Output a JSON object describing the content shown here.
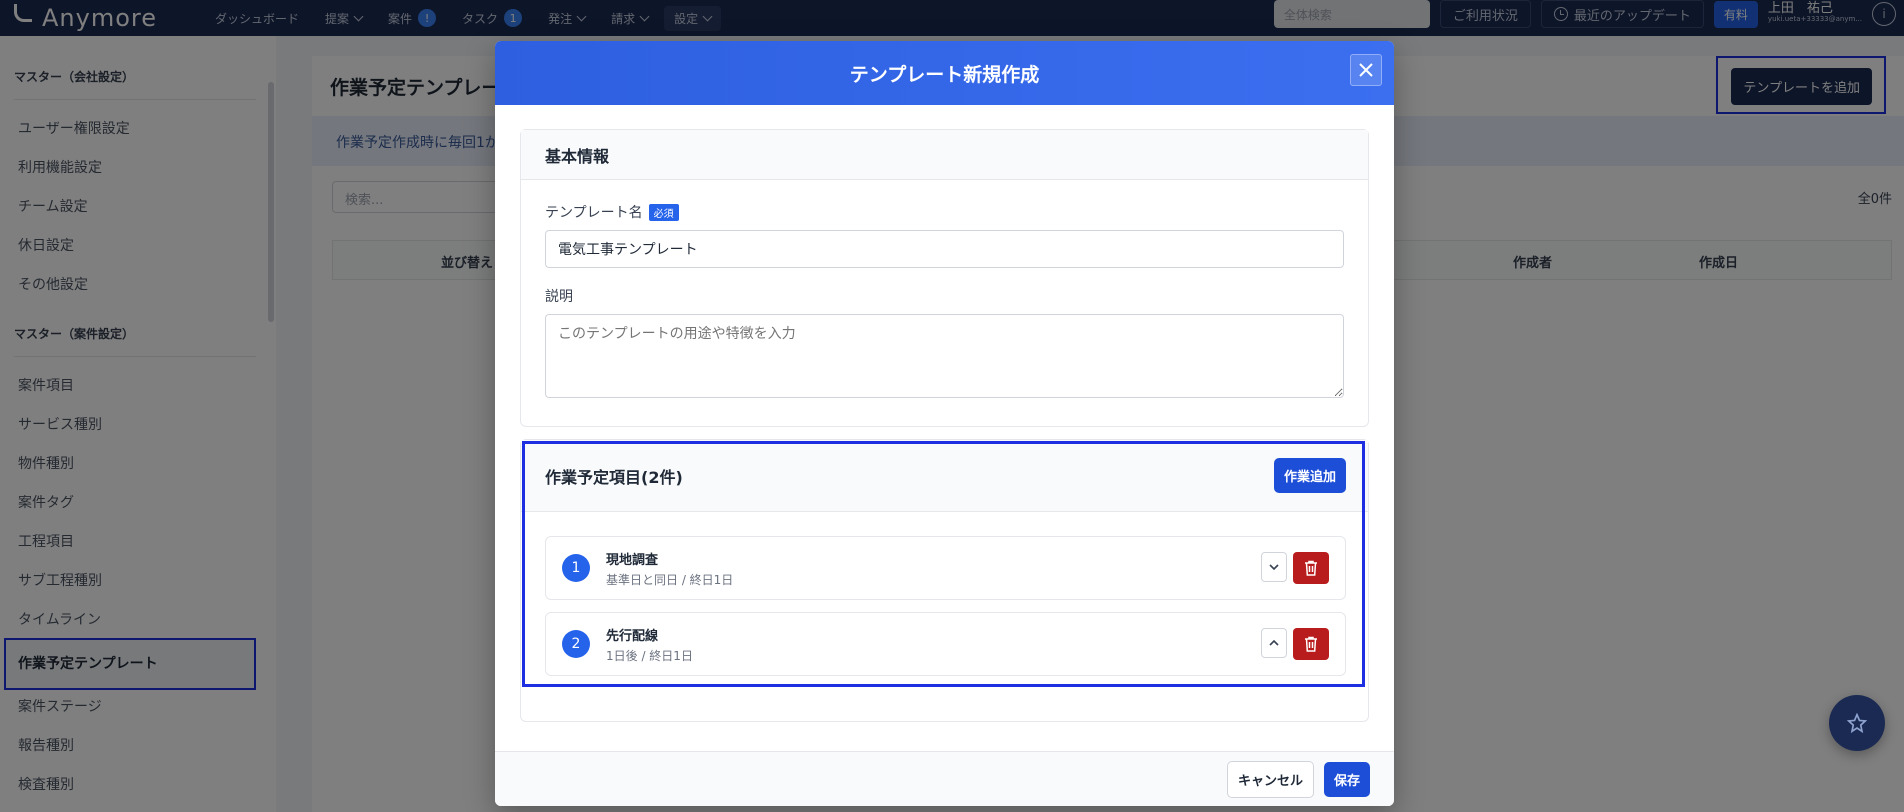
{
  "app": {
    "logo_text": "Anymore"
  },
  "topnav": {
    "items": [
      {
        "label": "ダッシュボード",
        "has_chevron": false
      },
      {
        "label": "提案",
        "has_chevron": true
      },
      {
        "label": "案件",
        "badge": "!"
      },
      {
        "label": "タスク",
        "badge": "1"
      },
      {
        "label": "発注",
        "has_chevron": true
      },
      {
        "label": "請求",
        "has_chevron": true
      },
      {
        "label": "設定",
        "has_chevron": true
      }
    ],
    "search_placeholder": "全体検索",
    "usage_label": "ご利用状況",
    "updates_label": "最近のアップデート",
    "plan_label": "有料",
    "user_name": "上田　祐己",
    "user_email": "yuki.ueta+33333@anym..."
  },
  "sidebar": {
    "section1_title": "マスター（会社設定）",
    "section1_items": [
      "ユーザー権限設定",
      "利用機能設定",
      "チーム設定",
      "休日設定",
      "その他設定"
    ],
    "section2_title": "マスター（案件設定）",
    "section2_items": [
      "案件項目",
      "サービス種別",
      "物件種別",
      "案件タグ",
      "工程項目",
      "サブ工程種別",
      "タイムライン",
      "作業予定テンプレート",
      "案件ステージ",
      "報告種別",
      "検査種別"
    ],
    "active_item": "作業予定テンプレート"
  },
  "main": {
    "page_title": "作業予定テンプレート",
    "add_button": "テンプレートを追加",
    "notice": "作業予定作成時に毎回1か",
    "search_placeholder": "検索...",
    "total_count": "全0件",
    "columns": {
      "sort": "並び替え",
      "creator": "作成者",
      "created": "作成日"
    }
  },
  "modal": {
    "title": "テンプレート新規作成",
    "basic_section_title": "基本情報",
    "name_label": "テンプレート名",
    "required_badge": "必須",
    "name_value": "電気工事テンプレート",
    "desc_label": "説明",
    "desc_placeholder": "このテンプレートの用途や特徴を入力",
    "tasks_title": "作業予定項目(2件)",
    "add_task_button": "作業追加",
    "tasks": [
      {
        "num": "1",
        "name": "現地調査",
        "detail": "基準日と同日 / 終日1日",
        "move": "down"
      },
      {
        "num": "2",
        "name": "先行配線",
        "detail": "1日後 / 終日1日",
        "move": "up"
      }
    ],
    "cancel_button": "キャンセル",
    "save_button": "保存"
  },
  "colors": {
    "nav_bg": "#1b2a52",
    "modal_header": "#2d5fe0",
    "primary": "#1d4ed8",
    "danger": "#b91c1c",
    "highlight_frame": "#1d2fe0"
  },
  "icons": {
    "close": "close-icon",
    "trash": "trash-icon",
    "chevron_up": "chevron-up-icon",
    "chevron_down": "chevron-down-icon",
    "star": "star-icon",
    "clock": "clock-icon",
    "info": "info-icon"
  }
}
